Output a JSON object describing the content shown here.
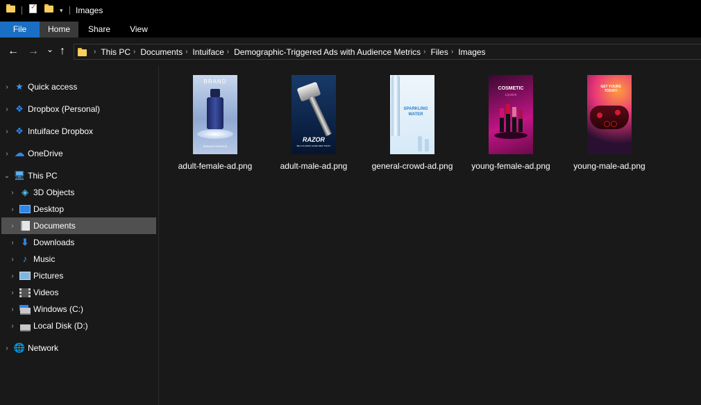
{
  "window": {
    "title": "Images"
  },
  "ribbon": {
    "tabs": [
      "File",
      "Home",
      "Share",
      "View"
    ]
  },
  "nav": {
    "back_icon": "←",
    "forward_icon": "→",
    "recent_icon": "⌄",
    "up_icon": "↑"
  },
  "breadcrumb": [
    "This PC",
    "Documents",
    "Intuiface",
    "Demographic-Triggered Ads with Audience Metrics",
    "Files",
    "Images"
  ],
  "sidebar": {
    "items": [
      {
        "label": "Quick access",
        "icon": "star-icon"
      },
      {
        "label": "Dropbox (Personal)",
        "icon": "dropbox-icon"
      },
      {
        "label": "Intuiface Dropbox",
        "icon": "dropbox-icon"
      },
      {
        "label": "OneDrive",
        "icon": "cloud-icon"
      },
      {
        "label": "This PC",
        "icon": "computer-icon"
      },
      {
        "label": "3D Objects",
        "icon": "cube-icon"
      },
      {
        "label": "Desktop",
        "icon": "desktop-icon"
      },
      {
        "label": "Documents",
        "icon": "document-icon"
      },
      {
        "label": "Downloads",
        "icon": "download-icon"
      },
      {
        "label": "Music",
        "icon": "music-icon"
      },
      {
        "label": "Pictures",
        "icon": "picture-icon"
      },
      {
        "label": "Videos",
        "icon": "video-icon"
      },
      {
        "label": "Windows (C:)",
        "icon": "drive-icon"
      },
      {
        "label": "Local Disk (D:)",
        "icon": "drive-icon"
      },
      {
        "label": "Network",
        "icon": "network-icon"
      }
    ]
  },
  "files": [
    {
      "name": "adult-female-ad.png",
      "thumb_text": [
        "BRAND",
        "SERUM ESSENCE"
      ]
    },
    {
      "name": "adult-male-ad.png",
      "thumb_text": [
        "RAZOR",
        "BE A CLASSIC GLIDE NEW TODAY"
      ]
    },
    {
      "name": "general-crowd-ad.png",
      "thumb_text": [
        "SPARKLING",
        "WATER"
      ]
    },
    {
      "name": "young-female-ad.png",
      "thumb_text": [
        "COSMETIC",
        "Lipstick"
      ]
    },
    {
      "name": "young-male-ad.png",
      "thumb_text": [
        "GET YOURS TODAY!"
      ]
    }
  ],
  "colors": {
    "accent": "#1a6fc4",
    "selected": "#505050",
    "background": "#191919",
    "folder": "#f7cf5b"
  }
}
